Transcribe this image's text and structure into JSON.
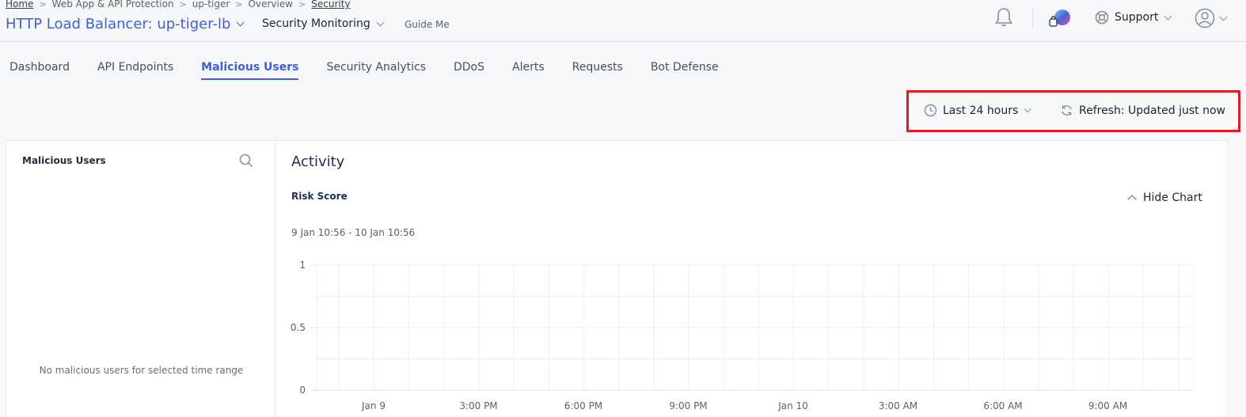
{
  "breadcrumb": [
    "Home",
    "Web App & API Protection",
    "up-tiger",
    "Overview",
    "Security"
  ],
  "header": {
    "lb_title": "HTTP Load Balancer: up-tiger-lb",
    "monitor_select": "Security Monitoring",
    "guide_me": "Guide Me",
    "support": "Support"
  },
  "icons": {
    "bell": "bell-icon",
    "support": "lifebuoy-icon",
    "user": "user-circle-icon",
    "clock": "clock-icon",
    "refresh": "refresh-icon",
    "search": "search-icon"
  },
  "tabs": [
    {
      "label": "Dashboard",
      "active": false
    },
    {
      "label": "API Endpoints",
      "active": false
    },
    {
      "label": "Malicious Users",
      "active": true
    },
    {
      "label": "Security Analytics",
      "active": false
    },
    {
      "label": "DDoS",
      "active": false
    },
    {
      "label": "Alerts",
      "active": false
    },
    {
      "label": "Requests",
      "active": false
    },
    {
      "label": "Bot Defense",
      "active": false
    }
  ],
  "toolbar": {
    "time_range": "Last 24 hours",
    "refresh": "Refresh: Updated just now"
  },
  "left_panel": {
    "title": "Malicious Users",
    "empty_message": "No malicious users for selected time range"
  },
  "activity": {
    "title": "Activity",
    "chart_title": "Risk Score",
    "hide_chart": "Hide Chart",
    "range": "9 Jan 10:56 - 10 Jan 10:56"
  },
  "chart_data": {
    "type": "line",
    "title": "Risk Score",
    "ylim": [
      0,
      1
    ],
    "y_ticks": [
      "1",
      "0.5",
      "0"
    ],
    "x_ticks": [
      "Jan 9",
      "3:00 PM",
      "6:00 PM",
      "9:00 PM",
      "Jan 10",
      "3:00 AM",
      "6:00 AM",
      "9:00 AM"
    ],
    "series": []
  },
  "colors": {
    "accent": "#3f5fd8",
    "highlight": "#e11b22"
  }
}
